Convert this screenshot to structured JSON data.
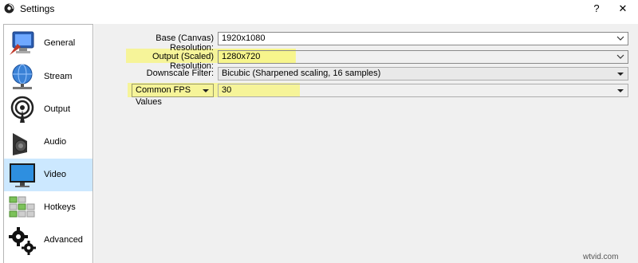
{
  "window": {
    "title": "Settings",
    "help_label": "?",
    "close_label": "✕"
  },
  "sidebar": {
    "items": [
      {
        "label": "General",
        "icon": "computer-monitor-icon",
        "active": false
      },
      {
        "label": "Stream",
        "icon": "globe-network-icon",
        "active": false
      },
      {
        "label": "Output",
        "icon": "broadcast-antenna-icon",
        "active": false
      },
      {
        "label": "Audio",
        "icon": "speaker-icon",
        "active": false
      },
      {
        "label": "Video",
        "icon": "monitor-icon",
        "active": true
      },
      {
        "label": "Hotkeys",
        "icon": "keyboard-icon",
        "active": false
      },
      {
        "label": "Advanced",
        "icon": "gears-icon",
        "active": false
      }
    ],
    "active_color": "#cce8ff"
  },
  "video": {
    "base_resolution": {
      "label": "Base (Canvas) Resolution:",
      "value": "1920x1080"
    },
    "output_resolution": {
      "label": "Output (Scaled) Resolution:",
      "value": "1280x720"
    },
    "downscale_filter": {
      "label": "Downscale Filter:",
      "value": "Bicubic (Sharpened scaling, 16 samples)"
    },
    "fps": {
      "type_label": "Common FPS Values",
      "value": "30"
    },
    "highlight_color": "#f7f58a"
  },
  "watermark": "wtvid.com"
}
